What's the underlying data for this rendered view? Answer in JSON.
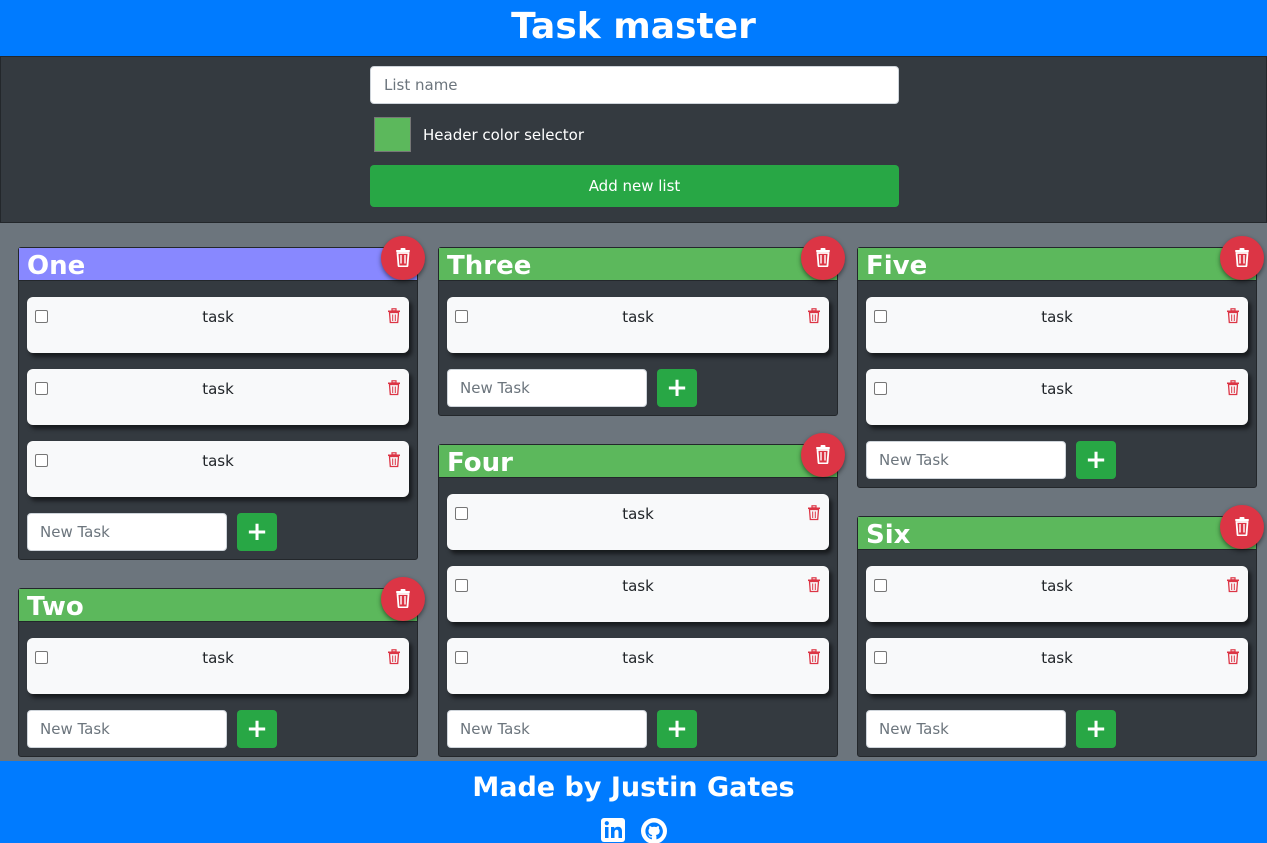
{
  "app": {
    "title": "Task master"
  },
  "form": {
    "list_name_placeholder": "List name",
    "color_label": "Header color selector",
    "color_value": "#5cb85c",
    "add_list_label": "Add new list"
  },
  "lists": [
    {
      "title": "One",
      "header_color": "#8888ff",
      "tasks": [
        "task",
        "task",
        "task"
      ],
      "new_task_placeholder": "New Task",
      "add_label": "+"
    },
    {
      "title": "Two",
      "header_color": "#5cb85c",
      "tasks": [
        "task"
      ],
      "new_task_placeholder": "New Task",
      "add_label": "+"
    },
    {
      "title": "Three",
      "header_color": "#5cb85c",
      "tasks": [
        "task"
      ],
      "new_task_placeholder": "New Task",
      "add_label": "+"
    },
    {
      "title": "Four",
      "header_color": "#5cb85c",
      "tasks": [
        "task",
        "task",
        "task"
      ],
      "new_task_placeholder": "New Task",
      "add_label": "+"
    },
    {
      "title": "Five",
      "header_color": "#5cb85c",
      "tasks": [
        "task",
        "task"
      ],
      "new_task_placeholder": "New Task",
      "add_label": "+"
    },
    {
      "title": "Six",
      "header_color": "#5cb85c",
      "tasks": [
        "task",
        "task"
      ],
      "new_task_placeholder": "New Task",
      "add_label": "+"
    }
  ],
  "footer": {
    "text": "Made by Justin Gates",
    "icons": [
      "linkedin-icon",
      "github-icon"
    ]
  },
  "colors": {
    "primary": "#007bff",
    "dark": "#343a40",
    "success": "#28a745",
    "danger": "#dc3545",
    "background": "#6c757d"
  }
}
